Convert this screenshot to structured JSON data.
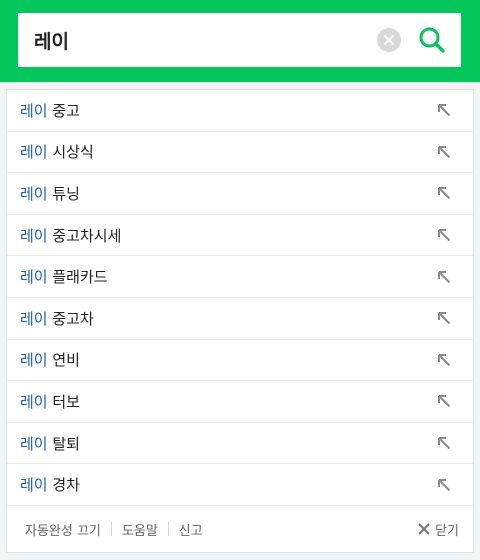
{
  "search": {
    "query": "레이"
  },
  "suggestions": [
    {
      "keyword": "레이",
      "rest": " 중고"
    },
    {
      "keyword": "레이",
      "rest": " 시상식"
    },
    {
      "keyword": "레이",
      "rest": " 튜닝"
    },
    {
      "keyword": "레이",
      "rest": " 중고차시세"
    },
    {
      "keyword": "레이",
      "rest": " 플래카드"
    },
    {
      "keyword": "레이",
      "rest": " 중고차"
    },
    {
      "keyword": "레이",
      "rest": " 연비"
    },
    {
      "keyword": "레이",
      "rest": " 터보"
    },
    {
      "keyword": "레이",
      "rest": " 탈퇴"
    },
    {
      "keyword": "레이",
      "rest": " 경차"
    }
  ],
  "footer": {
    "autocomplete_off": "자동완성 끄기",
    "help": "도움말",
    "report": "신고",
    "close": "닫기"
  },
  "colors": {
    "brand": "#03c75a",
    "keyword": "#1a5fb4"
  },
  "icons": {
    "clear": "clear-icon",
    "search": "search-icon",
    "insert": "arrow-up-left-icon",
    "close": "close-icon"
  }
}
